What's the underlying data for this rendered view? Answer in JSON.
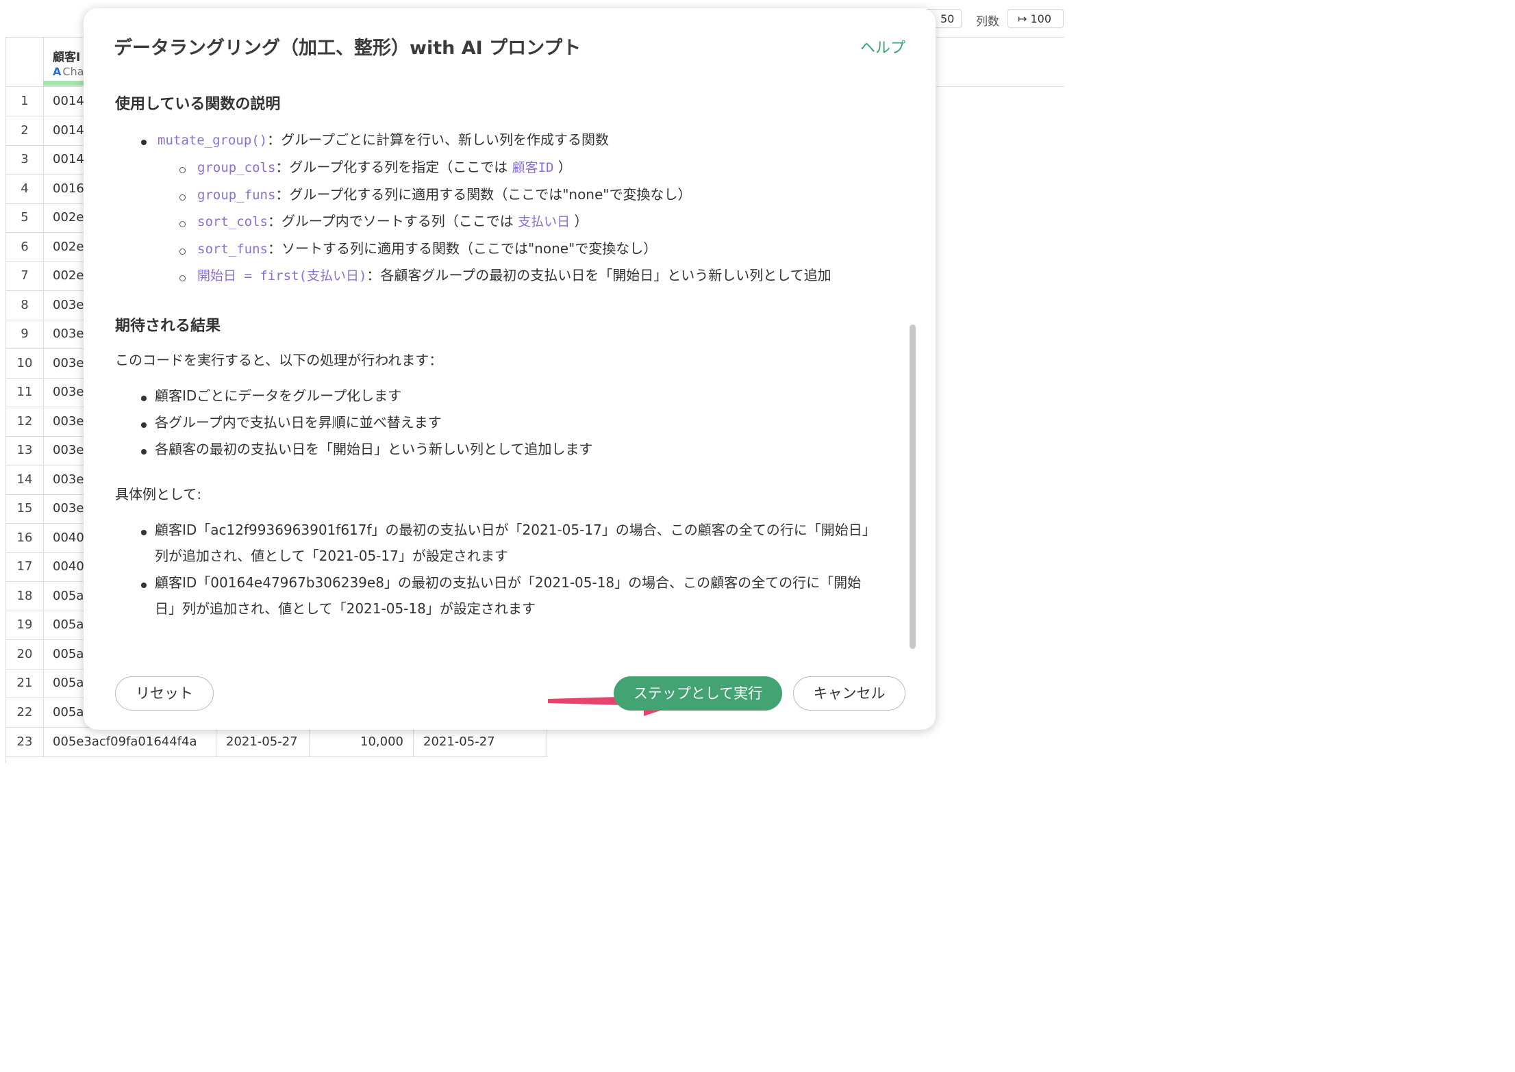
{
  "toolbar": {
    "rows_value": "50",
    "cols_label": "列数",
    "cols_value": "↦ 100"
  },
  "table": {
    "column_title": "顧客I",
    "column_type": "Cha",
    "column_type_icon": "A",
    "rows": [
      {
        "n": "1",
        "c1": "0014"
      },
      {
        "n": "2",
        "c1": "0014"
      },
      {
        "n": "3",
        "c1": "0014"
      },
      {
        "n": "4",
        "c1": "0016"
      },
      {
        "n": "5",
        "c1": "002e"
      },
      {
        "n": "6",
        "c1": "002e"
      },
      {
        "n": "7",
        "c1": "002e"
      },
      {
        "n": "8",
        "c1": "003e"
      },
      {
        "n": "9",
        "c1": "003e"
      },
      {
        "n": "10",
        "c1": "003e"
      },
      {
        "n": "11",
        "c1": "003e"
      },
      {
        "n": "12",
        "c1": "003e"
      },
      {
        "n": "13",
        "c1": "003e"
      },
      {
        "n": "14",
        "c1": "003e"
      },
      {
        "n": "15",
        "c1": "003e"
      },
      {
        "n": "16",
        "c1": "0040"
      },
      {
        "n": "17",
        "c1": "0040"
      },
      {
        "n": "18",
        "c1": "005a"
      },
      {
        "n": "19",
        "c1": "005a"
      },
      {
        "n": "20",
        "c1": "005a"
      },
      {
        "n": "21",
        "c1": "005a"
      },
      {
        "n": "22",
        "c1": "005a"
      }
    ],
    "last_row": {
      "n": "23",
      "c1": "005e3acf09fa01644f4a",
      "c2": "2021-05-27",
      "c3": "10,000",
      "c4": "2021-05-27"
    }
  },
  "modal": {
    "title": "データラングリング（加工、整形）with AI プロンプト",
    "help": "ヘルプ",
    "section1_title": "使用している関数の説明",
    "func_main_code": "mutate_group()",
    "func_main_desc": "：グループごとに計算を行い、新しい列を作成する関数",
    "params": [
      {
        "code": "group_cols",
        "desc": "：グループ化する列を指定（ここでは ",
        "code2": "顧客ID",
        "tail": " ）"
      },
      {
        "code": "group_funs",
        "desc": "：グループ化する列に適用する関数（ここでは\"none\"で変換なし）",
        "code2": "",
        "tail": ""
      },
      {
        "code": "sort_cols",
        "desc": "：グループ内でソートする列（ここでは ",
        "code2": "支払い日",
        "tail": " ）"
      },
      {
        "code": "sort_funs",
        "desc": "：ソートする列に適用する関数（ここでは\"none\"で変換なし）",
        "code2": "",
        "tail": ""
      },
      {
        "code": "開始日 = first(支払い日)",
        "desc": "：各顧客グループの最初の支払い日を「開始日」という新しい列として追加",
        "code2": "",
        "tail": ""
      }
    ],
    "section2_title": "期待される結果",
    "intro": "このコードを実行すると、以下の処理が行われます：",
    "results": [
      "顧客IDごとにデータをグループ化します",
      "各グループ内で支払い日を昇順に並べ替えます",
      "各顧客の最初の支払い日を「開始日」という新しい列として追加します"
    ],
    "example_label": "具体例として:",
    "examples": [
      {
        "l1": "顧客ID「ac12f9936963901f617f」の最初の支払い日が「2021-05-17」の場合、この顧客の全ての行に「開始日」",
        "l2": "列が追加され、値として「2021-05-17」が設定されます"
      },
      {
        "l1": "顧客ID「00164e47967b306239e8」の最初の支払い日が「2021-05-18」の場合、この顧客の全ての行に「開始",
        "l2": "日」列が追加され、値として「2021-05-18」が設定されます"
      }
    ],
    "buttons": {
      "reset": "リセット",
      "run": "ステップとして実行",
      "cancel": "キャンセル"
    },
    "colors": {
      "accent": "#44a373",
      "code": "#8a6fd6",
      "arrow": "#e8436d"
    }
  }
}
